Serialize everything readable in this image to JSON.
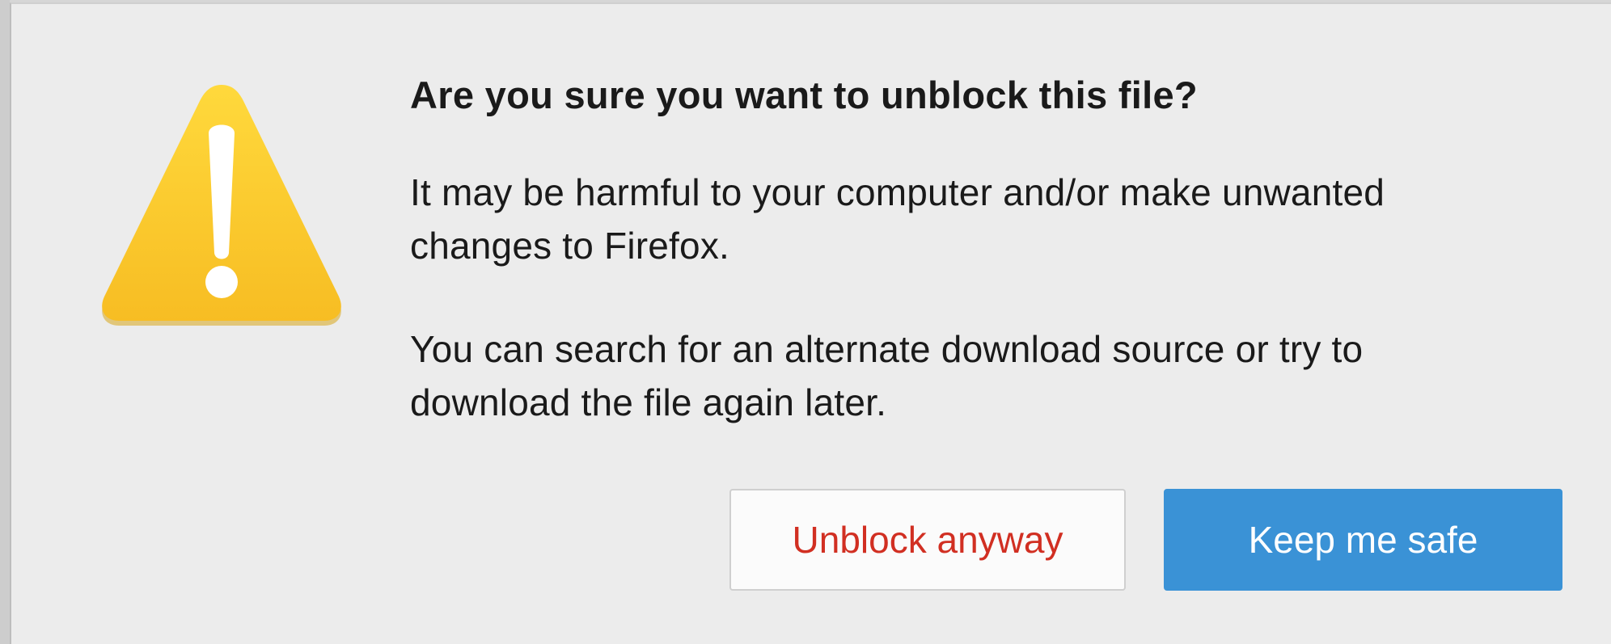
{
  "dialog": {
    "title": "Are you sure you want to unblock this file?",
    "message_1_line_1": "It may be harmful to your computer and/or make unwanted",
    "message_1_line_2": "changes to Firefox.",
    "message_2_line_1": "You can search for an alternate download source or try to",
    "message_2_line_2": "download the file again later.",
    "icon": "warning-triangle-icon"
  },
  "buttons": {
    "unblock_label": "Unblock anyway",
    "safe_label": "Keep me safe"
  },
  "colors": {
    "unblock_text": "#d12f22",
    "primary_button": "#3a92d6",
    "icon_yellow": "#fbc62a"
  }
}
